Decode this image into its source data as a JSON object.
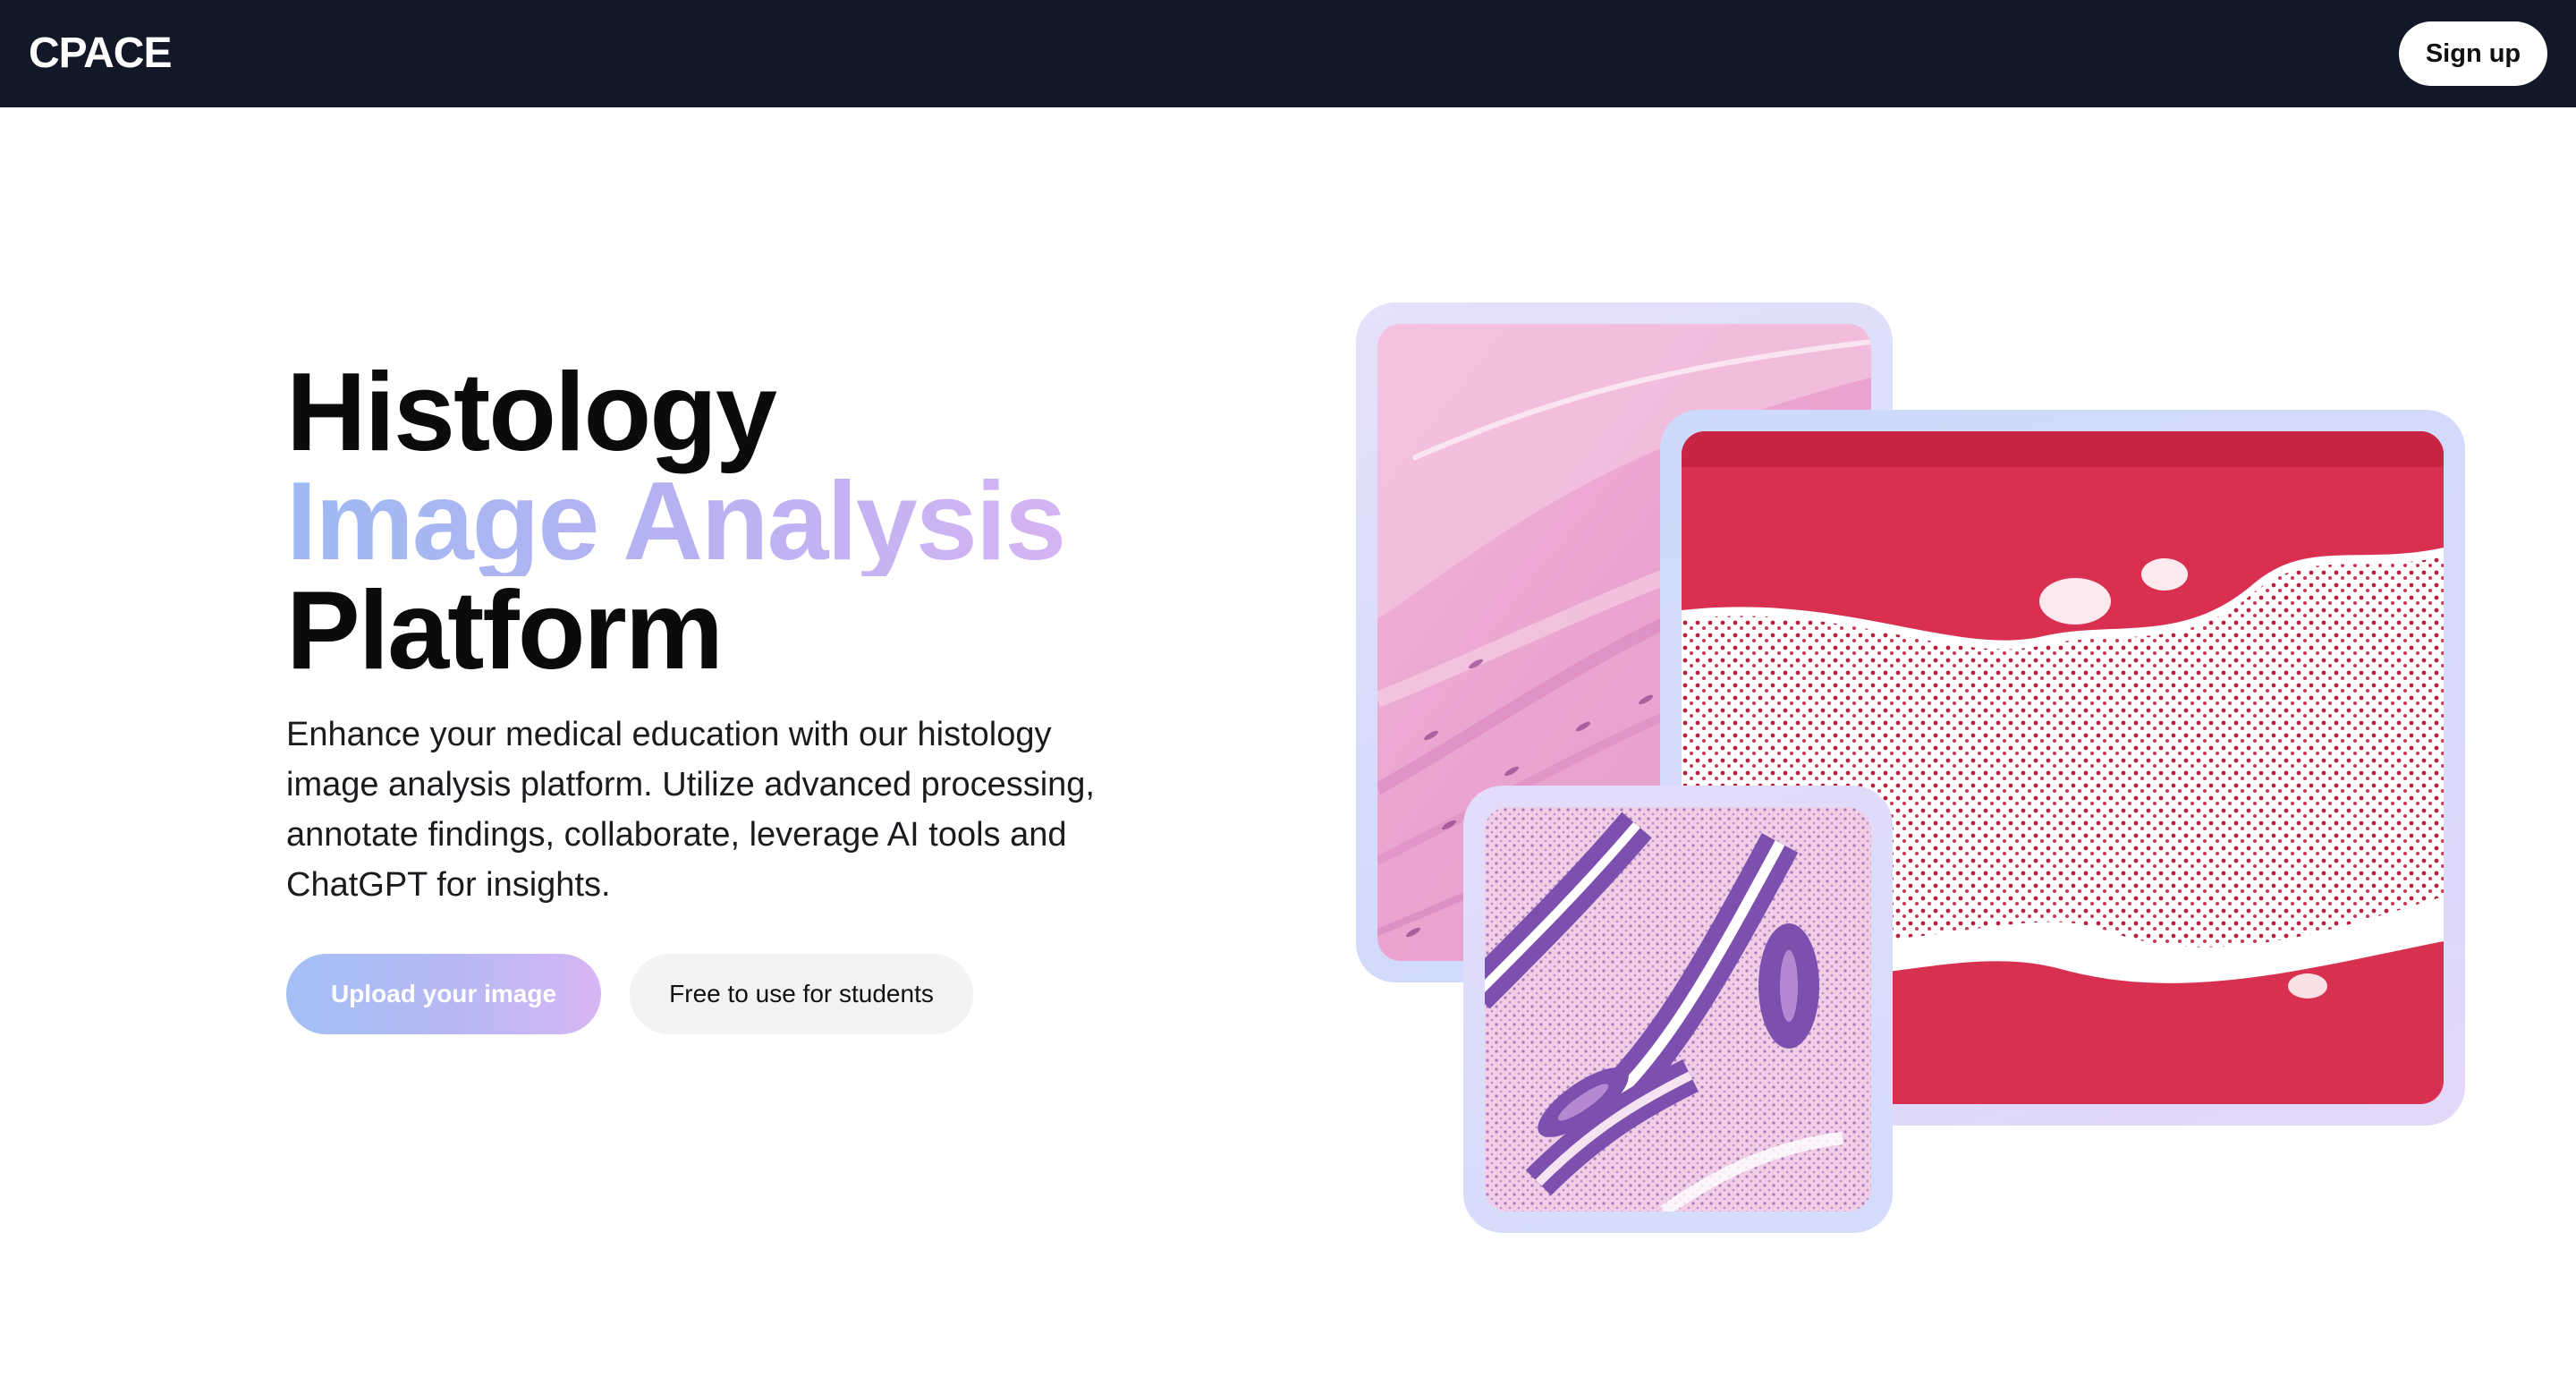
{
  "header": {
    "logo": "CPACE",
    "signup_label": "Sign up"
  },
  "hero": {
    "title_line1": "Histology",
    "title_line2": "Image Analysis",
    "title_line3": "Platform",
    "description": "Enhance your medical education with our histology image analysis platform. Utilize advanced processing, annotate findings, collaborate, leverage AI tools and ChatGPT for insights.",
    "upload_label": "Upload your image",
    "free_label": "Free to use for students"
  },
  "colors": {
    "topbar": "#131828",
    "accent_gradient_start": "#9ebaf3",
    "accent_gradient_end": "#d5b4f3",
    "secondary_button": "#f2f3f5"
  },
  "images": [
    {
      "name": "histology-image-smooth-muscle"
    },
    {
      "name": "histology-image-bone-marrow"
    },
    {
      "name": "histology-image-glandular-tissue"
    }
  ]
}
